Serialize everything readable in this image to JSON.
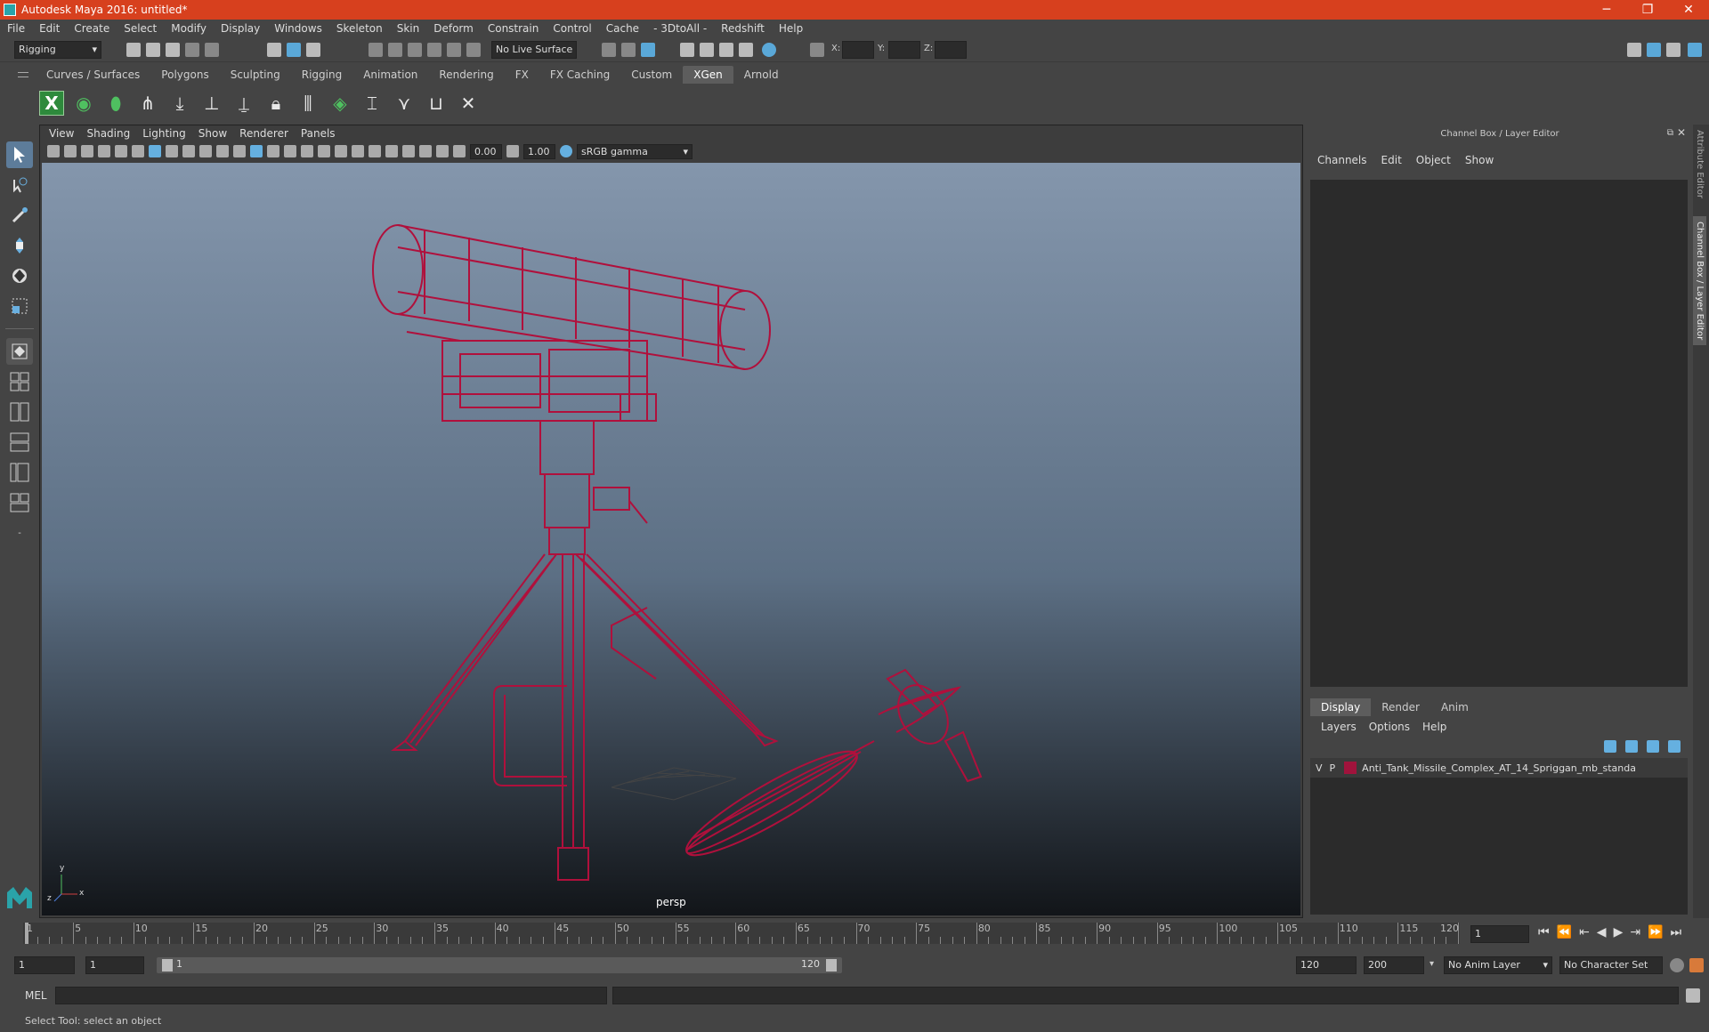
{
  "window": {
    "title": "Autodesk Maya 2016: untitled*",
    "controls": [
      "─",
      "❐",
      "✕"
    ]
  },
  "menubar": [
    "File",
    "Edit",
    "Create",
    "Select",
    "Modify",
    "Display",
    "Windows",
    "Skeleton",
    "Skin",
    "Deform",
    "Constrain",
    "Control",
    "Cache",
    "- 3DtoAll -",
    "Redshift",
    "Help"
  ],
  "statusline": {
    "menuset": "Rigging",
    "live_surface": "No Live Surface",
    "x_label": "X:",
    "y_label": "Y:",
    "z_label": "Z:"
  },
  "shelf_tabs": [
    "Curves / Surfaces",
    "Polygons",
    "Sculpting",
    "Rigging",
    "Animation",
    "Rendering",
    "FX",
    "FX Caching",
    "Custom",
    "XGen",
    "Arnold"
  ],
  "shelf_active": "XGen",
  "panel": {
    "menu": [
      "View",
      "Shading",
      "Lighting",
      "Show",
      "Renderer",
      "Panels"
    ],
    "exposure": "0.00",
    "gamma": "1.00",
    "color_space": "sRGB gamma",
    "camera": "persp",
    "axis_x": "x",
    "axis_y": "y",
    "axis_z": "z"
  },
  "channelbox": {
    "title": "Channel Box / Layer Editor",
    "menu": [
      "Channels",
      "Edit",
      "Object",
      "Show"
    ]
  },
  "layer_editor": {
    "tabs": [
      "Display",
      "Render",
      "Anim"
    ],
    "active_tab": "Display",
    "menu": [
      "Layers",
      "Options",
      "Help"
    ],
    "layers": [
      {
        "v": "V",
        "p": "P",
        "name": "Anti_Tank_Missile_Complex_AT_14_Spriggan_mb_standa",
        "color": "#a0133c"
      }
    ]
  },
  "side_tabs": [
    "Attribute Editor",
    "Channel Box / Layer Editor"
  ],
  "timeline": {
    "labels": [
      "1",
      "5",
      "10",
      "15",
      "20",
      "25",
      "30",
      "35",
      "40",
      "45",
      "50",
      "55",
      "60",
      "65",
      "70",
      "75",
      "80",
      "85",
      "90",
      "95",
      "100",
      "105",
      "110",
      "115",
      "120"
    ],
    "current_frame": "1"
  },
  "range": {
    "start": "1",
    "anim_start": "1",
    "slider_start": "1",
    "slider_end": "120",
    "end": "120",
    "anim_end": "200",
    "anim_layer": "No Anim Layer",
    "character_set": "No Character Set"
  },
  "cmdline": {
    "label": "MEL"
  },
  "helpline": {
    "text": "Select Tool: select an object"
  },
  "colors": {
    "wireframe": "#b0103c",
    "titlebar": "#d7401e"
  }
}
